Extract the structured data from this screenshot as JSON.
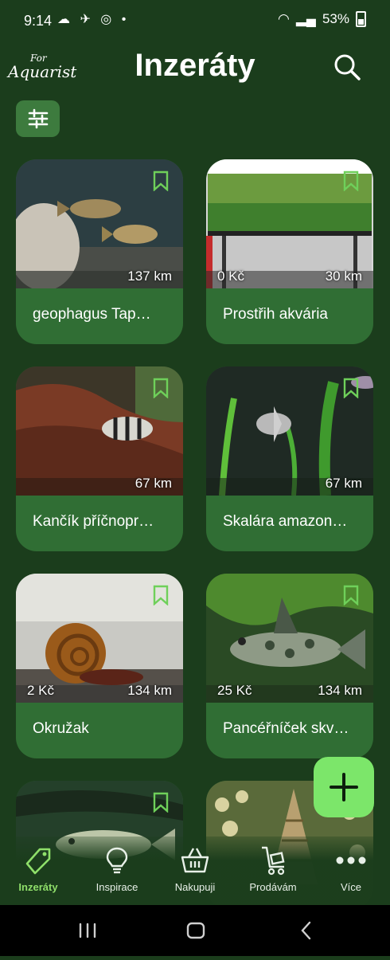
{
  "status": {
    "time": "9:14",
    "battery": "53%"
  },
  "header": {
    "logo_top": "For",
    "logo_bottom": "Aquarist",
    "title": "Inzeráty"
  },
  "cards": [
    {
      "name": "geophagus Tap…",
      "distance": "137 km",
      "price": ""
    },
    {
      "name": "Prostřih akvária",
      "distance": "30 km",
      "price": "0 Kč"
    },
    {
      "name": "Kančík příčnopr…",
      "distance": "67 km",
      "price": ""
    },
    {
      "name": "Skalára amazon…",
      "distance": "67 km",
      "price": ""
    },
    {
      "name": "Okružak",
      "distance": "134 km",
      "price": "2 Kč"
    },
    {
      "name": "Pancéřníček skv…",
      "distance": "134 km",
      "price": "25 Kč"
    }
  ],
  "nav": [
    {
      "label": "Inzeráty",
      "icon": "tag-icon",
      "active": true
    },
    {
      "label": "Inspirace",
      "icon": "lightbulb-icon",
      "active": false
    },
    {
      "label": "Nakupuji",
      "icon": "basket-icon",
      "active": false
    },
    {
      "label": "Prodávám",
      "icon": "cart-icon",
      "active": false
    },
    {
      "label": "Více",
      "icon": "more-icon",
      "active": false
    }
  ],
  "colors": {
    "background": "#1b3d1c",
    "card": "#306e34",
    "accent": "#7ce66a",
    "active_nav": "#8fdf6a"
  }
}
